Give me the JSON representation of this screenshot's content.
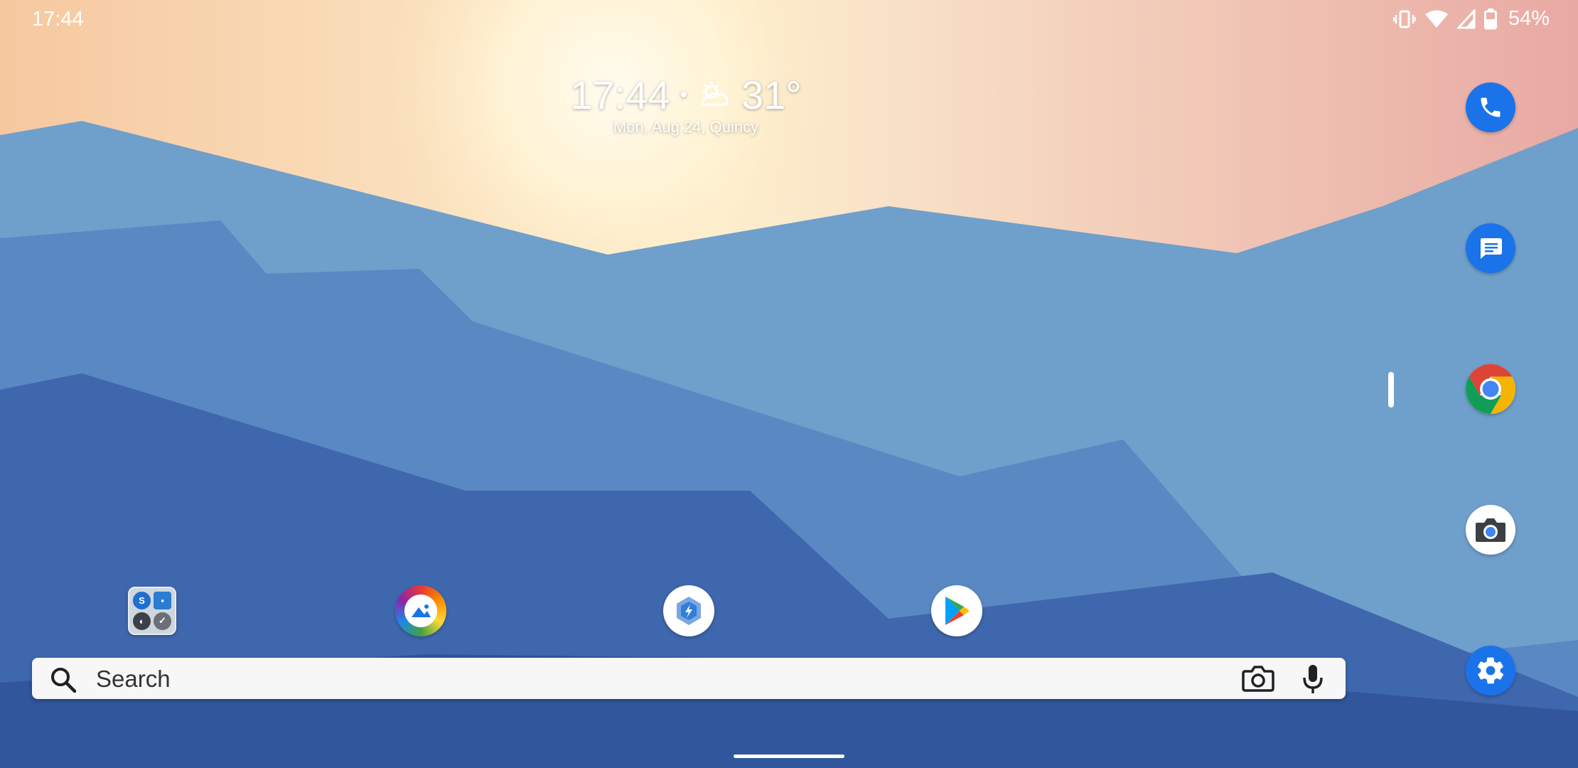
{
  "status_bar": {
    "time": "17:44",
    "battery_percent": "54%",
    "icons": [
      "vibrate-icon",
      "wifi-icon",
      "cell-signal-icon",
      "battery-icon"
    ]
  },
  "clock_widget": {
    "time": "17:44",
    "temperature": "31°",
    "date": "Mon, Aug 24",
    "location": "Quincy",
    "weather_icon": "partly-cloudy-icon"
  },
  "home_apps": [
    {
      "name": "app-folder",
      "icon": "folder-icon"
    },
    {
      "name": "gallery",
      "icon": "gallery-icon"
    },
    {
      "name": "power-apps",
      "icon": "power-apps-icon"
    },
    {
      "name": "play-store",
      "icon": "play-store-icon"
    }
  ],
  "dock": [
    {
      "name": "phone",
      "icon": "phone-icon",
      "color": "#1a73e8"
    },
    {
      "name": "messages",
      "icon": "messages-icon",
      "color": "#1a73e8"
    },
    {
      "name": "chrome",
      "icon": "chrome-icon",
      "color": "#ffffff"
    },
    {
      "name": "camera",
      "icon": "camera-icon",
      "color": "#ffffff"
    },
    {
      "name": "settings",
      "icon": "settings-icon",
      "color": "#1a73e8"
    }
  ],
  "search": {
    "placeholder": "Search"
  },
  "colors": {
    "sky_top": "#f1b49a",
    "sun": "#fff8e0",
    "mountain_far": "#6f9fcb",
    "mountain_mid": "#5580bd",
    "mountain_near": "#3a62a8",
    "mountain_front": "#2c4f95"
  }
}
